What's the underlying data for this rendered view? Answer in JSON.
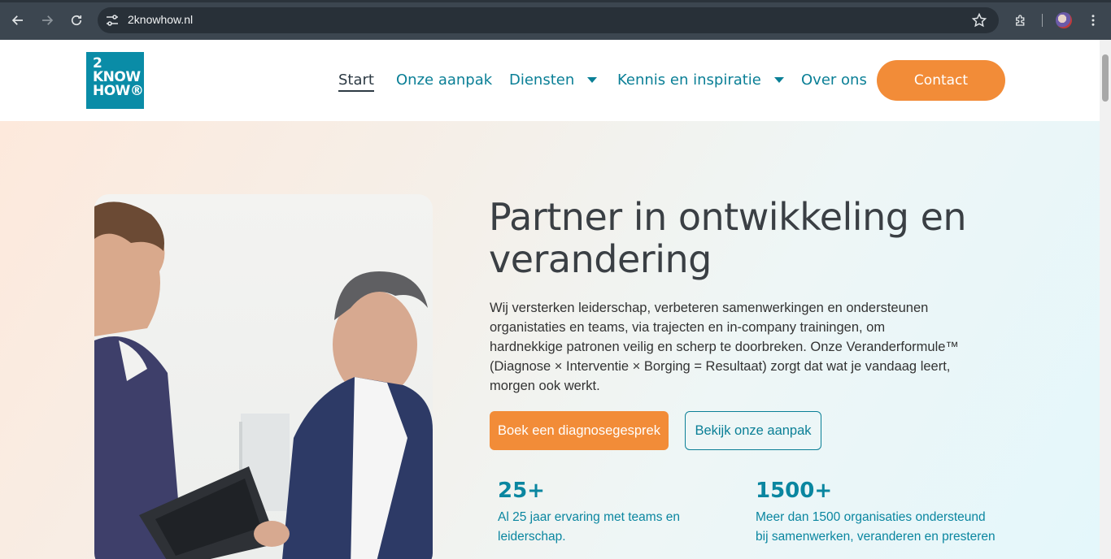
{
  "browser": {
    "url": "2knowhow.nl",
    "icons": {
      "back": "back-arrow-icon",
      "forward": "forward-arrow-icon",
      "reload": "reload-icon",
      "site_settings": "tune-icon",
      "bookmark": "star-icon",
      "extensions": "puzzle-icon",
      "menu": "more-vert-icon"
    }
  },
  "header": {
    "logo_lines": [
      "2",
      "KNOW",
      "HOW®"
    ],
    "nav": [
      {
        "label": "Start",
        "active": true,
        "dropdown": false
      },
      {
        "label": "Onze aanpak",
        "active": false,
        "dropdown": false
      },
      {
        "label": "Diensten",
        "active": false,
        "dropdown": true
      },
      {
        "label": "Kennis en inspiratie",
        "active": false,
        "dropdown": true
      },
      {
        "label": "Over ons",
        "active": false,
        "dropdown": false
      }
    ],
    "contact_label": "Contact"
  },
  "hero": {
    "title": "Partner in ontwikkeling en verandering",
    "text": "Wij versterken leiderschap, verbeteren samenwerkingen en ondersteunen organistaties en teams, via trajecten en in-company trainingen, om hardnekkige patronen veilig en scherp te doorbreken. Onze Veranderformule™ (Diagnose × Interventie × Borging = Resultaat) zorgt dat wat je vandaag leert, morgen ook werkt.",
    "primary_cta": "Boek een diagnosegesprek",
    "secondary_cta": "Bekijk onze aanpak",
    "stats": [
      {
        "number": "25+",
        "description": "Al 25 jaar ervaring met teams en leiderschap."
      },
      {
        "number": "1500+",
        "description": "Meer dan 1500 organisaties ondersteund bij samenwerken, veranderen en presteren"
      }
    ]
  },
  "colors": {
    "brand_teal": "#0a8ca7",
    "accent_orange": "#f28c38",
    "text_dark": "#3a3f44"
  }
}
